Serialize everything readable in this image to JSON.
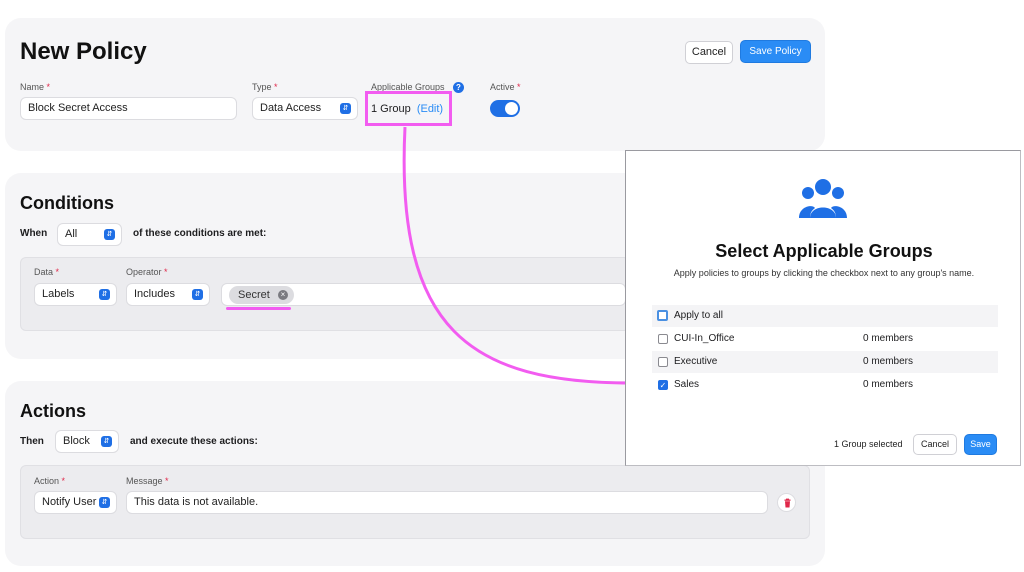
{
  "policy": {
    "title": "New Policy",
    "cancel_label": "Cancel",
    "save_label": "Save Policy",
    "name_label": "Name",
    "name_value": "Block Secret Access",
    "type_label": "Type",
    "type_value": "Data Access",
    "groups_label": "Applicable Groups",
    "groups_value": "1 Group",
    "groups_edit": "(Edit)",
    "active_label": "Active",
    "required_mark": "*"
  },
  "conditions": {
    "title": "Conditions",
    "when_label": "When",
    "match_value": "All",
    "suffix": "of these conditions are met:",
    "data_label": "Data",
    "data_value": "Labels",
    "operator_label": "Operator",
    "operator_value": "Includes",
    "tag_value": "Secret"
  },
  "actions": {
    "title": "Actions",
    "then_label": "Then",
    "action_value": "Block",
    "suffix": "and execute these actions:",
    "action_label": "Action",
    "action_select": "Notify User",
    "message_label": "Message",
    "message_value": "This data is not available."
  },
  "modal": {
    "title": "Select Applicable Groups",
    "description": "Apply policies to groups by clicking the checkbox next to any group's name.",
    "rows": [
      {
        "name": "Apply to all",
        "members": "",
        "checked": false
      },
      {
        "name": "CUI-In_Office",
        "members": "0 members",
        "checked": false
      },
      {
        "name": "Executive",
        "members": "0 members",
        "checked": false
      },
      {
        "name": "Sales",
        "members": "0 members",
        "checked": true
      }
    ],
    "selected_count": "1 Group selected",
    "cancel_label": "Cancel",
    "save_label": "Save"
  },
  "colors": {
    "accent": "#2a8cf5",
    "highlight": "#f25cf0",
    "danger": "#e0284a"
  },
  "icons": [
    "help-icon",
    "toggle-switch",
    "chevron-updown-icon",
    "remove-tag-icon",
    "trash-icon",
    "group-icon"
  ]
}
